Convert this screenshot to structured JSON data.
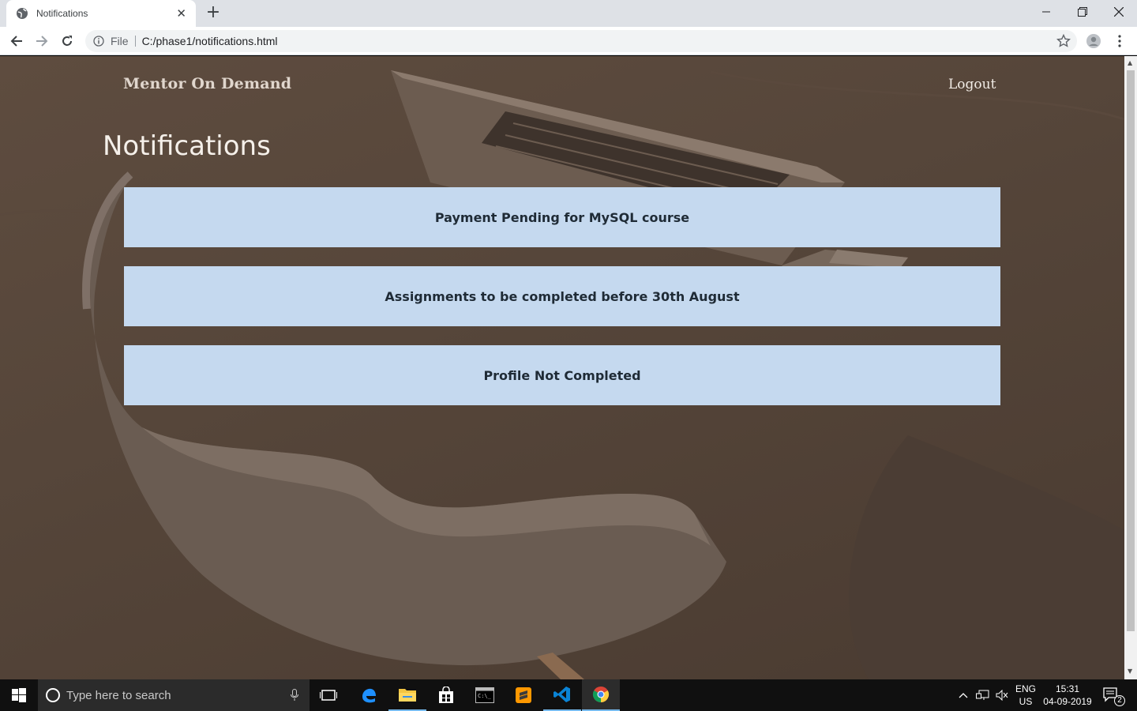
{
  "browser": {
    "tab_title": "Notifications",
    "url_scheme": "File",
    "url": "C:/phase1/notifications.html"
  },
  "page": {
    "brand": "Mentor On Demand",
    "logout": "Logout",
    "heading": "Notifications",
    "notifications": [
      "Payment Pending for MySQL course",
      "Assignments to be completed before 30th August",
      "Profile Not Completed"
    ]
  },
  "taskbar": {
    "search_placeholder": "Type here to search",
    "lang": "ENG",
    "region": "US",
    "time": "15:31",
    "date": "04-09-2019",
    "notification_count": "2"
  },
  "colors": {
    "card_bg": "#c5d9ef",
    "page_overlay": "#4f4035"
  }
}
